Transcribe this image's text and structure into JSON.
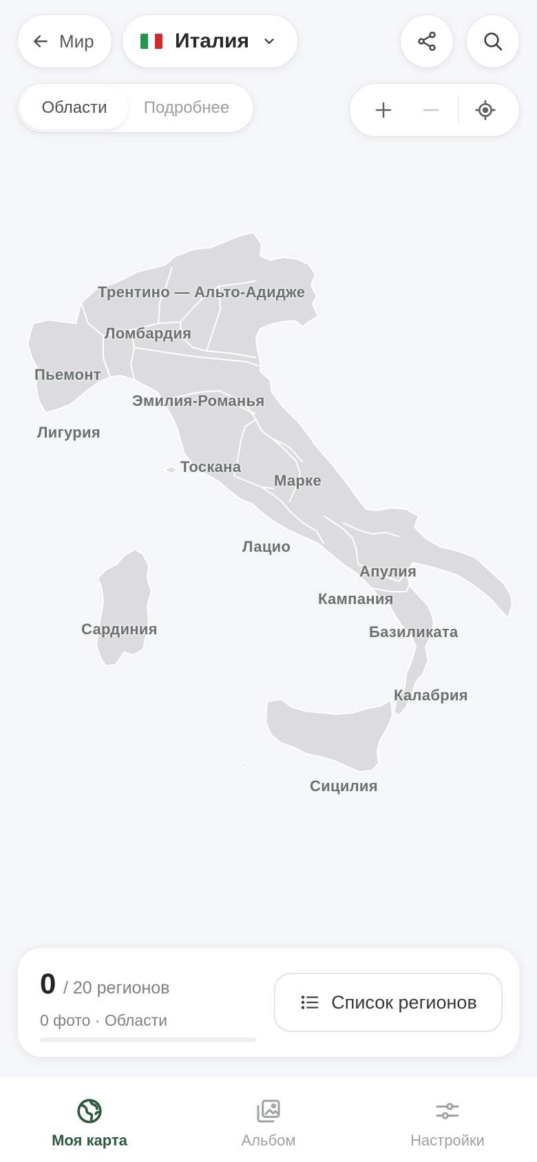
{
  "header": {
    "back_label": "Мир",
    "country": "Италия",
    "flag_colors": [
      "#1e9a49",
      "#ffffff",
      "#d3272c"
    ]
  },
  "segmented": {
    "items": [
      "Области",
      "Подробнее"
    ],
    "active": "Области"
  },
  "map": {
    "fill_color": "#dcdcde",
    "border_color": "#ffffff",
    "regions": [
      "Трентино — Альто-Адидже",
      "Ломбардия",
      "Пьемонт",
      "Эмилия-Романья",
      "Лигурия",
      "Тоскана",
      "Марке",
      "Лацио",
      "Апулия",
      "Кампания",
      "Базиликата",
      "Сардиния",
      "Калабрия",
      "Сицилия"
    ]
  },
  "summary": {
    "visited_count": "0",
    "total_text": "/ 20 регионов",
    "meta": "0 фото · Области",
    "progress_fraction": 0,
    "list_button_label": "Список регионов"
  },
  "tabs": [
    {
      "label": "Моя карта",
      "active": true
    },
    {
      "label": "Альбом",
      "active": false
    },
    {
      "label": "Настройки",
      "active": false
    }
  ],
  "colors": {
    "accent": "#2d5a3a",
    "background": "#f5f6f8"
  }
}
